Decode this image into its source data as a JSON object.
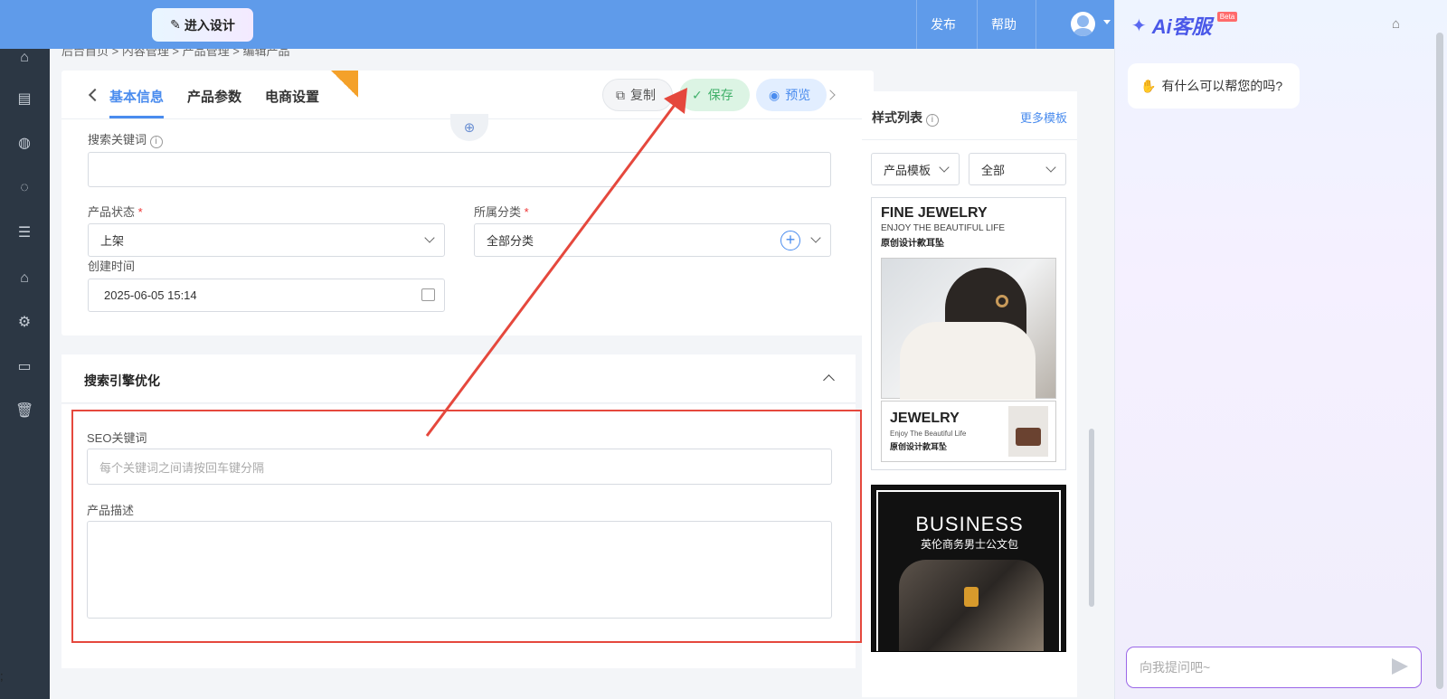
{
  "topbar": {
    "design_button": "进入设计",
    "publish": "发布",
    "help": "帮助"
  },
  "breadcrumb": "后台首页 > 内容管理 > 产品管理 > 编辑产品",
  "tabs": [
    {
      "label": "基本信息"
    },
    {
      "label": "产品参数"
    },
    {
      "label": "电商设置"
    }
  ],
  "actions": {
    "copy": "复制",
    "save": "保存",
    "preview": "预览"
  },
  "fields": {
    "search_keywords_label": "搜索关键词",
    "product_status_label": "产品状态",
    "product_status_value": "上架",
    "category_label": "所属分类",
    "category_value": "全部分类",
    "created_label": "创建时间",
    "created_value": "2025-06-05 15:14",
    "required_mark": "*"
  },
  "seo": {
    "title": "搜索引擎优化",
    "keywords_label": "SEO关键词",
    "keywords_placeholder": "每个关键词之间请按回车键分隔",
    "description_label": "产品描述"
  },
  "style_panel": {
    "title": "样式列表",
    "more": "更多模板",
    "filter_type": "产品模板",
    "filter_all": "全部",
    "templates": [
      {
        "title": "FINE JEWELRY",
        "subtitle": "ENJOY THE BEAUTIFUL LIFE",
        "cn": "原创设计款耳坠",
        "title2": "JEWELRY",
        "subtitle2": "Enjoy The Beautiful Life",
        "cn2": "原创设计款耳坠"
      },
      {
        "title": "BUSINESS",
        "cn": "英伦商务男士公文包"
      }
    ]
  },
  "chatbot": {
    "brand": "Ai客服",
    "badge": "Beta",
    "greeting": "有什么可以帮您的吗?",
    "input_placeholder": "向我提问吧~"
  },
  "colors": {
    "accent": "#4a8cee",
    "topbar": "#5f9bea",
    "sidebar": "#2c3744",
    "highlight": "#e5483d",
    "save_green": "#41b06a"
  },
  "footer_glyph": ";"
}
